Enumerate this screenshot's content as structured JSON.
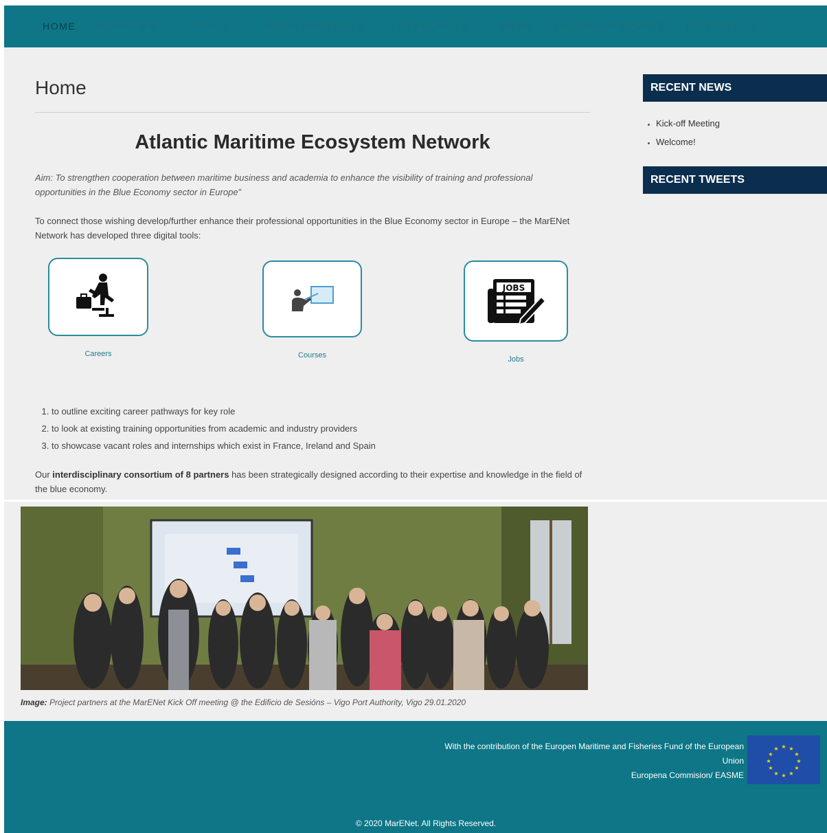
{
  "nav": {
    "items": [
      {
        "label": "HOME",
        "chevron": false
      },
      {
        "label": "ABOUT US",
        "chevron": true
      },
      {
        "label": "TOOLS",
        "chevron": true
      },
      {
        "label": "WORK PACKAGES",
        "chevron": true
      },
      {
        "label": "RESOURCES",
        "chevron": true
      },
      {
        "label": "NEWS",
        "chevron": false
      },
      {
        "label": "CALENDAR EVENTS",
        "chevron": false
      },
      {
        "label": "CONTACT US",
        "chevron": true
      }
    ],
    "chevron_glyph": "⌄"
  },
  "main": {
    "page_title": "Home",
    "heading": "Atlantic Maritime Ecosystem Network",
    "aim": "Aim: To strengthen cooperation between maritime business and academia to enhance the visibility of training and professional opportunities in the Blue Economy sector in Europe”",
    "intro": "To connect those wishing develop/further enhance their professional opportunities in the Blue Economy sector in Europe – the MarENet Network has developed three digital tools:",
    "tools": [
      {
        "label": "Careers",
        "icon": "careers-stairs-icon"
      },
      {
        "label": "Courses",
        "icon": "courses-presentation-icon"
      },
      {
        "label": "Jobs",
        "icon": "jobs-newspaper-icon",
        "icon_text": "JOBS"
      }
    ],
    "steps": [
      "to outline exciting career pathways for key role",
      "to look at existing training opportunities from academic and industry providers",
      "to showcase vacant roles and internships which exist in France, Ireland and Spain"
    ],
    "consortium_prefix": "Our ",
    "consortium_bold": "interdisciplinary consortium of 8 partners",
    "consortium_suffix": " has been strategically designed according to their expertise and knowledge in the field of the blue economy.",
    "caption_label": "Image:",
    "caption_text": " Project partners at the MarENet Kick Off meeting @ the Edificio de Sesións – Vigo Port Authority, Vigo  29.01.2020"
  },
  "sidebar": {
    "recent_news_title": "RECENT NEWS",
    "news": [
      "Kick-off Meeting",
      "Welcome!"
    ],
    "recent_tweets_title": "RECENT TWEETS"
  },
  "footer": {
    "line1": "With the contribution of the Europen Maritime and Fisheries Fund of the European",
    "line2": "Union",
    "line3": "Europena Commision/ EASME",
    "copyright": "© 2020 MarENet. All Rights Reserved."
  },
  "colors": {
    "teal": "#0e7686",
    "navy": "#0b2e4f",
    "tool_border": "#2a8c9b"
  }
}
